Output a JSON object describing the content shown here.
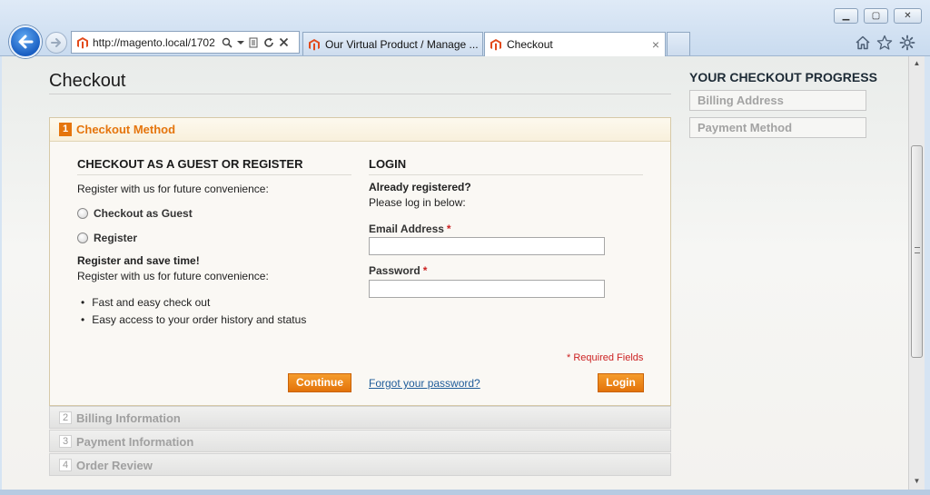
{
  "browser": {
    "window_controls": {
      "minimize": "▁",
      "maximize": "▢",
      "close": "✕"
    },
    "address_url": "http://magento.local/1702",
    "tabs": [
      {
        "label": "Our Virtual Product / Manage ..."
      },
      {
        "label": "Checkout"
      }
    ],
    "tab_close": "×"
  },
  "page": {
    "title": "Checkout"
  },
  "progress": {
    "title": "YOUR CHECKOUT PROGRESS",
    "items": [
      {
        "label": "Billing Address"
      },
      {
        "label": "Payment Method"
      }
    ]
  },
  "steps": {
    "active": {
      "number": "1",
      "label": "Checkout Method"
    },
    "collapsed": [
      {
        "number": "2",
        "label": "Billing Information"
      },
      {
        "number": "3",
        "label": "Payment Information"
      },
      {
        "number": "4",
        "label": "Order Review"
      }
    ]
  },
  "guest": {
    "title": "CHECKOUT AS A GUEST OR REGISTER",
    "intro": "Register with us for future convenience:",
    "options": [
      {
        "label": "Checkout as Guest"
      },
      {
        "label": "Register"
      }
    ],
    "save_title": "Register and save time!",
    "save_text": "Register with us for future convenience:",
    "benefits": [
      "Fast and easy check out",
      "Easy access to your order history and status"
    ],
    "continue_label": "Continue"
  },
  "login": {
    "title": "LOGIN",
    "already": "Already registered?",
    "please": "Please log in below:",
    "email_label": "Email Address",
    "email_value": "",
    "password_label": "Password",
    "password_value": "",
    "required_mark": "*",
    "required_note": "* Required Fields",
    "forgot_link": "Forgot your password?",
    "login_label": "Login"
  },
  "colors": {
    "accent": "#e5750d",
    "link": "#1e5b99",
    "required": "#cc2222"
  }
}
